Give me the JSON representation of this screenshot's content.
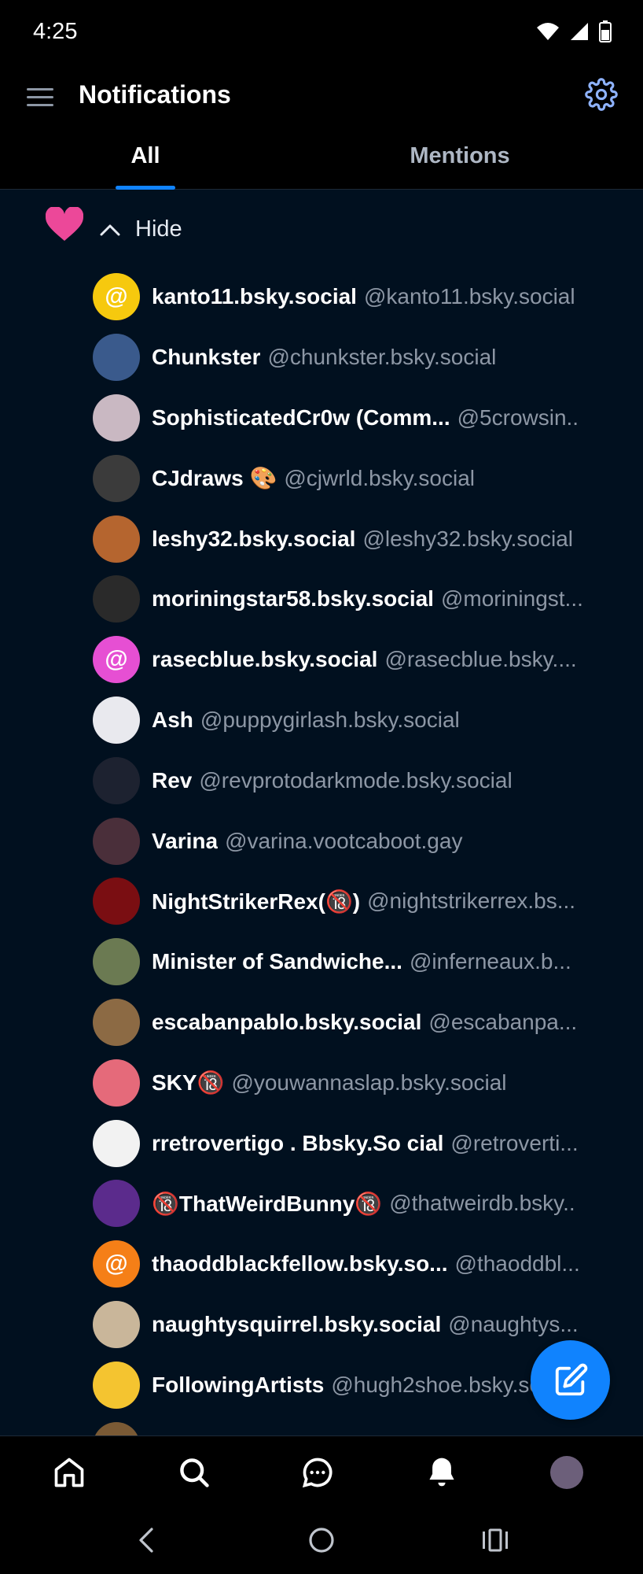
{
  "status_bar": {
    "time": "4:25"
  },
  "header": {
    "title": "Notifications"
  },
  "tabs": [
    {
      "label": "All",
      "active": true
    },
    {
      "label": "Mentions",
      "active": false
    }
  ],
  "group": {
    "toggle_label": "Hide",
    "icon": "heart-icon",
    "heart_color": "#ec4899"
  },
  "users": [
    {
      "name": "kanto11.bsky.social",
      "handle": "@kanto11.bsky.social",
      "avatar_color": "#f6c90e",
      "avatar_text": "@"
    },
    {
      "name": "Chunkster",
      "handle": "@chunkster.bsky.social",
      "avatar_color": "#3a5a8c",
      "avatar_text": ""
    },
    {
      "name": "SophisticatedCr0w (Comm...",
      "handle": "@5crowsin..",
      "avatar_color": "#c9b8c2",
      "avatar_text": ""
    },
    {
      "name": "CJdraws 🎨",
      "handle": "@cjwrld.bsky.social",
      "avatar_color": "#3b3b3b",
      "avatar_text": ""
    },
    {
      "name": "leshy32.bsky.social",
      "handle": "@leshy32.bsky.social",
      "avatar_color": "#b5652f",
      "avatar_text": ""
    },
    {
      "name": "moriningstar58.bsky.social",
      "handle": "@moriningst...",
      "avatar_color": "#2a2a2a",
      "avatar_text": ""
    },
    {
      "name": "rasecblue.bsky.social",
      "handle": "@rasecblue.bsky....",
      "avatar_color": "#e64fd3",
      "avatar_text": "@"
    },
    {
      "name": "Ash",
      "handle": "@puppygirlash.bsky.social",
      "avatar_color": "#e9e9ee",
      "avatar_text": ""
    },
    {
      "name": "Rev",
      "handle": "@revprotodarkmode.bsky.social",
      "avatar_color": "#1d2230",
      "avatar_text": ""
    },
    {
      "name": "Varina",
      "handle": "@varina.vootcaboot.gay",
      "avatar_color": "#4a2f3a",
      "avatar_text": ""
    },
    {
      "name": "NightStrikerRex(🔞)",
      "handle": "@nightstrikerrex.bs...",
      "avatar_color": "#7a0e12",
      "avatar_text": ""
    },
    {
      "name": "Minister of Sandwiche...",
      "handle": "@inferneaux.b...",
      "avatar_color": "#6b7a52",
      "avatar_text": ""
    },
    {
      "name": "escabanpablo.bsky.social",
      "handle": "@escabanpa...",
      "avatar_color": "#8c6a44",
      "avatar_text": ""
    },
    {
      "name": "SKY🔞",
      "handle": "@youwannaslap.bsky.social",
      "avatar_color": "#e56a7a",
      "avatar_text": ""
    },
    {
      "name": "rretrovertigo . Bbsky.So cial",
      "handle": "@retroverti...",
      "avatar_color": "#f2f2f2",
      "avatar_text": ""
    },
    {
      "name": "🔞ThatWeirdBunny🔞",
      "handle": "@thatweirdb.bsky..",
      "avatar_color": "#5b2b8c",
      "avatar_text": ""
    },
    {
      "name": "thaoddblackfellow.bsky.so...",
      "handle": "@thaoddbl...",
      "avatar_color": "#f57f17",
      "avatar_text": "@"
    },
    {
      "name": "naughtysquirrel.bsky.social",
      "handle": "@naughtys...",
      "avatar_color": "#c9b69a",
      "avatar_text": ""
    },
    {
      "name": "FollowingArtists",
      "handle": "@hugh2shoe.bsky.social",
      "avatar_color": "#f4c430",
      "avatar_text": ""
    },
    {
      "name": "",
      "handle": "",
      "avatar_color": "#7a5a35",
      "avatar_text": ""
    }
  ],
  "fab": {
    "icon": "compose-icon"
  },
  "bottom_nav": [
    "home-icon",
    "search-icon",
    "chat-icon",
    "bell-icon",
    "profile-avatar"
  ],
  "colors": {
    "accent": "#1083fe",
    "background": "#01101f",
    "handle": "#8d97a5"
  }
}
